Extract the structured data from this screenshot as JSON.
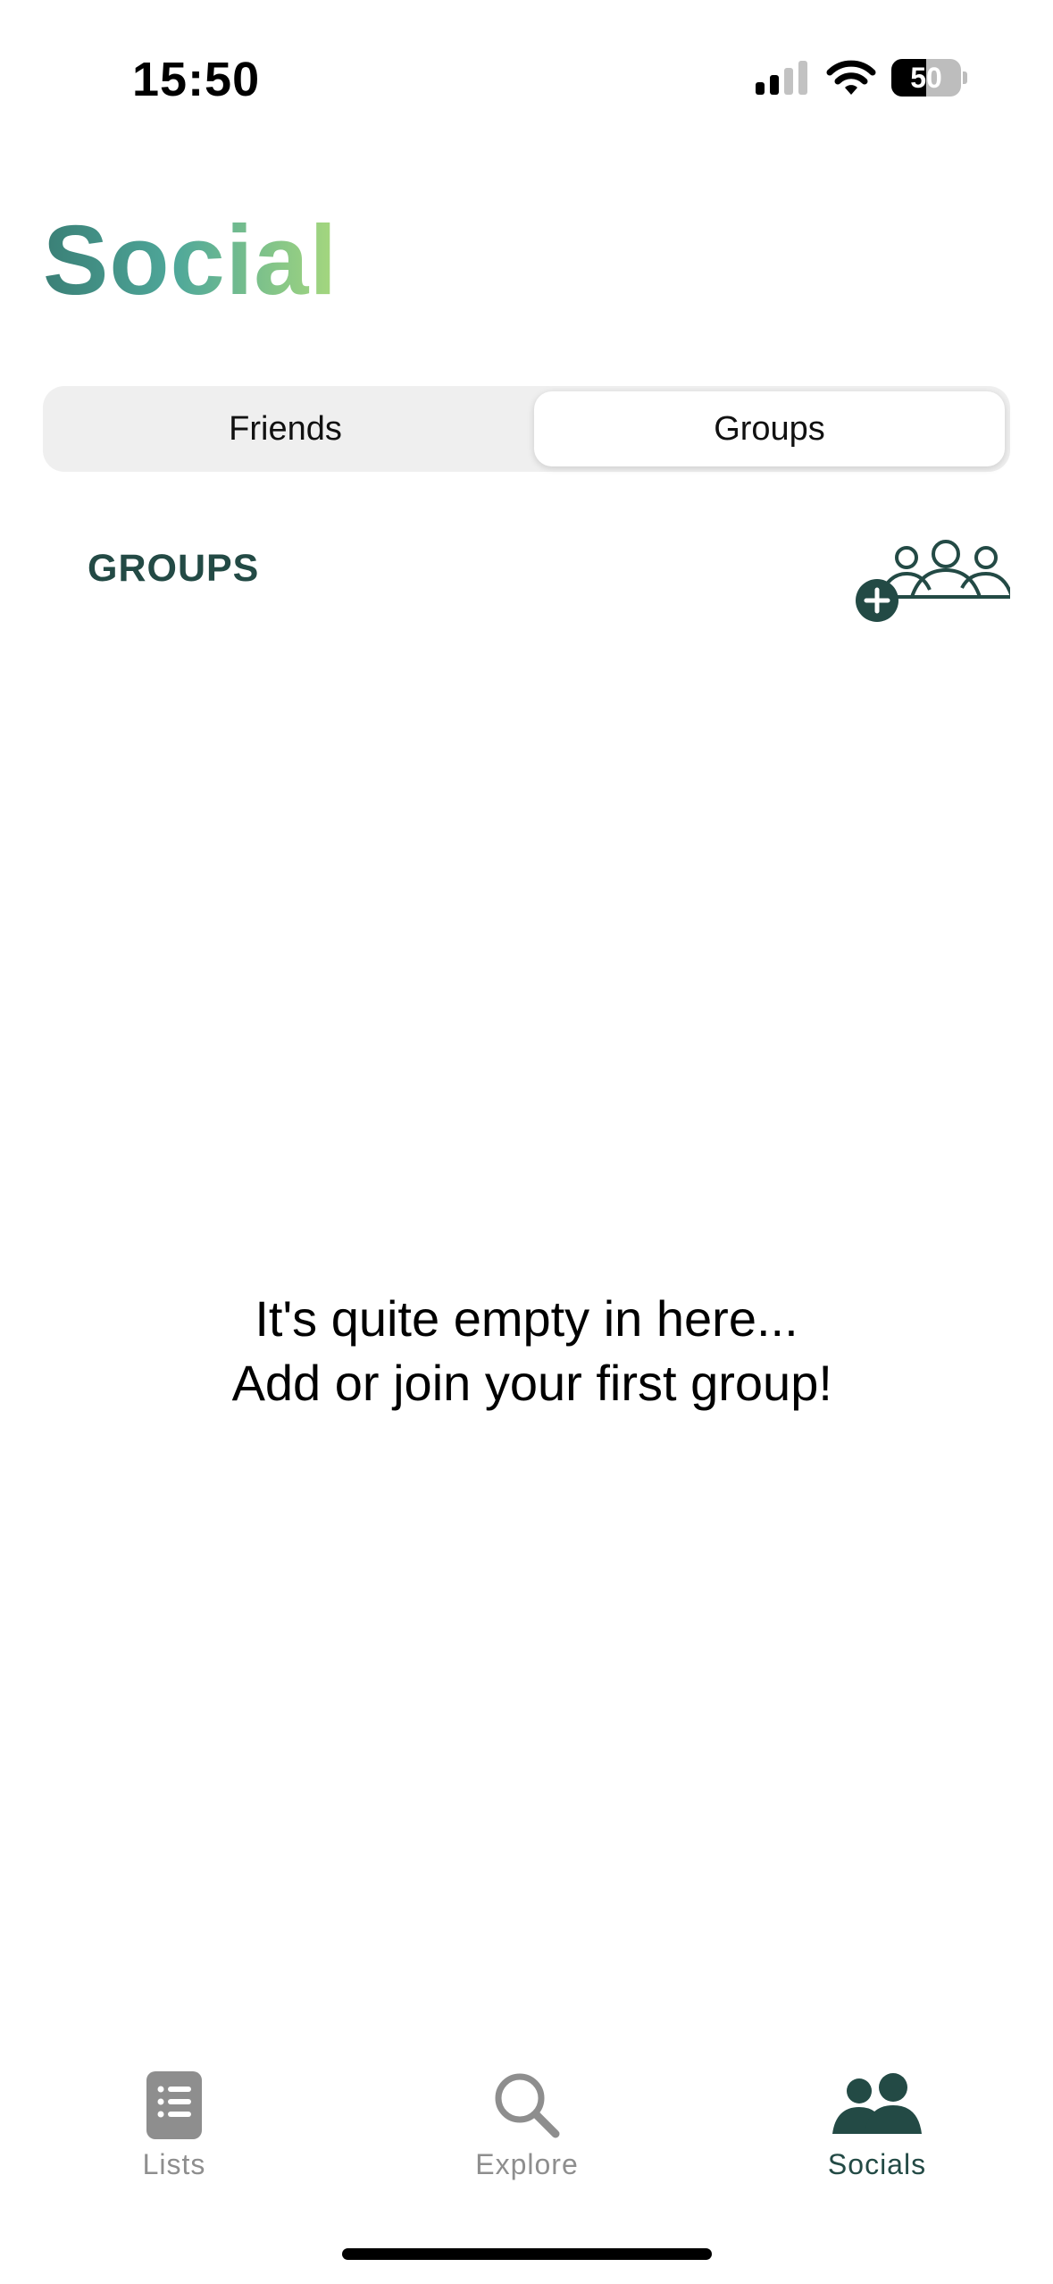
{
  "status_bar": {
    "time": "15:50",
    "battery_level": "50"
  },
  "header": {
    "title": "Social"
  },
  "segmented_control": {
    "options": [
      "Friends",
      "Groups"
    ],
    "selected": "Groups"
  },
  "groups_section": {
    "heading": "GROUPS",
    "add_icon": "add-group-icon"
  },
  "empty_state": {
    "line1": "It's quite empty in here...",
    "line2": " Add or join your first group!"
  },
  "tab_bar": {
    "tabs": [
      {
        "label": "Lists",
        "icon": "list-icon"
      },
      {
        "label": "Explore",
        "icon": "search-icon"
      },
      {
        "label": "Socials",
        "icon": "people-icon"
      }
    ],
    "selected": "Socials"
  },
  "colors": {
    "accent": "#234a45",
    "title_gradient_start": "#3a7f76",
    "title_gradient_end": "#a7d87d",
    "inactive": "#8e8e8e"
  }
}
